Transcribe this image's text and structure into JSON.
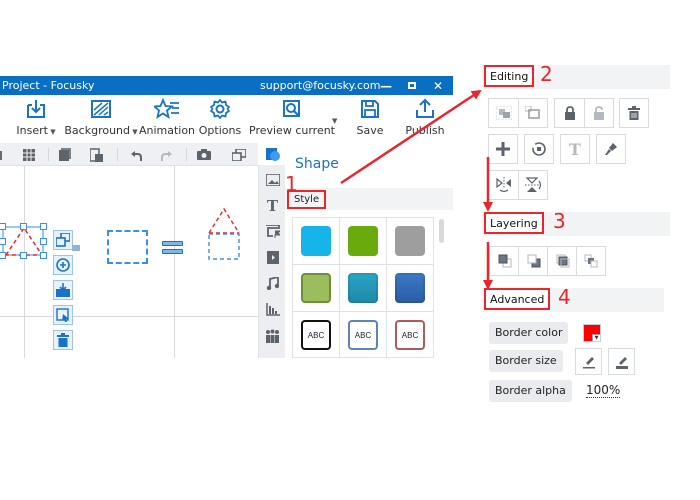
{
  "window": {
    "title": "Project - Focusky",
    "account_email": "support@focusky.com",
    "controls": {
      "minimize": "—",
      "maximize": "☐",
      "close": "✕"
    }
  },
  "ribbon": {
    "buttons": [
      {
        "id": "insert",
        "label": "Insert",
        "icon": "insert-icon",
        "dropdown": true
      },
      {
        "id": "background",
        "label": "Background",
        "icon": "background-icon",
        "dropdown": true
      },
      {
        "id": "animation",
        "label": "Animation",
        "icon": "animation-star-icon",
        "dropdown": false
      },
      {
        "id": "options",
        "label": "Options",
        "icon": "gear-icon",
        "dropdown": false
      },
      {
        "id": "preview",
        "label": "Preview current",
        "icon": "preview-magnifier-icon",
        "dropdown": true
      },
      {
        "id": "save",
        "label": "Save",
        "icon": "floppy-disk-icon",
        "dropdown": false
      },
      {
        "id": "publish",
        "label": "Publish",
        "icon": "upload-icon",
        "dropdown": false
      }
    ]
  },
  "canvas_toolbar": {
    "icons": [
      "grid-icon",
      "copy-icon",
      "paste-icon",
      "undo-icon",
      "redo-icon",
      "camera-icon",
      "window-icon"
    ]
  },
  "canvas": {
    "selection_tools": [
      "group-icon",
      "add-circle-icon",
      "inbox-download-icon",
      "select-frame-icon",
      "trash-icon"
    ],
    "equals_sign": "="
  },
  "side_strip": {
    "icons": [
      "shape-icon",
      "image-icon",
      "text-icon",
      "slide-flag-icon",
      "video-icon",
      "music-icon",
      "chart-icon",
      "people-icon"
    ]
  },
  "shape_panel": {
    "title": "Shape",
    "tab": "Style",
    "swatches": [
      {
        "type": "fill",
        "color": "#16b4e9"
      },
      {
        "type": "fill",
        "color": "#69ab0c"
      },
      {
        "type": "fill",
        "color": "#9e9e9e"
      },
      {
        "type": "fill-border",
        "color": "#9cbd5c",
        "border": "#6e8f3a"
      },
      {
        "type": "gradient",
        "color": "#2aa5c7",
        "color2": "#1f89a8"
      },
      {
        "type": "gradient",
        "color": "#3d79c7",
        "color2": "#2a5da2"
      },
      {
        "type": "text",
        "label": "ABC",
        "border": "#111111"
      },
      {
        "type": "text",
        "label": "ABC",
        "border": "#5b85b8"
      },
      {
        "type": "text",
        "label": "ABC",
        "border": "#b05a5e"
      }
    ]
  },
  "annotations": {
    "step1": "1",
    "step2": "2",
    "step3": "3",
    "step4": "4",
    "color": "#e8262b"
  },
  "properties": {
    "editing": {
      "label": "Editing",
      "buttons": [
        "group-icon",
        "ungroup-icon",
        "lock-icon",
        "unlock-icon",
        "trash-icon",
        "plus-icon",
        "rotate-reset-icon",
        "text-icon",
        "brush-icon",
        "flip-horizontal-icon",
        "flip-vertical-icon"
      ]
    },
    "layering": {
      "label": "Layering",
      "buttons": [
        "bring-to-front-icon",
        "send-to-back-icon",
        "bring-forward-icon",
        "send-backward-icon"
      ]
    },
    "advanced": {
      "label": "Advanced",
      "border_color_label": "Border color",
      "border_color_value": "#ff0000",
      "border_size_label": "Border size",
      "border_alpha_label": "Border alpha",
      "border_alpha_value": "100%"
    }
  }
}
